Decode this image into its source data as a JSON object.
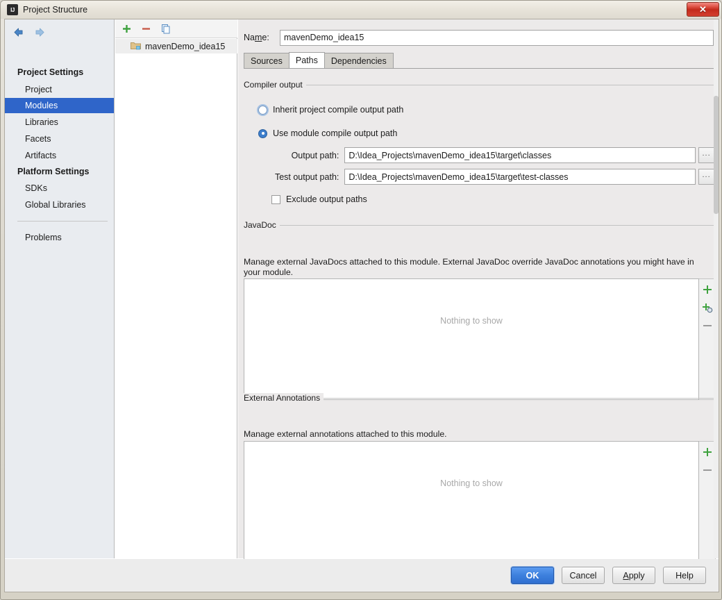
{
  "window": {
    "title": "Project Structure",
    "app_icon": "intellij-idea-icon",
    "close_label": "✕"
  },
  "sidebar": {
    "nav": {
      "back_icon": "arrow-left-icon",
      "forward_icon": "arrow-right-icon"
    },
    "groups": [
      {
        "header": "Project Settings",
        "items": [
          {
            "label": "Project",
            "selected": false
          },
          {
            "label": "Modules",
            "selected": true
          },
          {
            "label": "Libraries",
            "selected": false
          },
          {
            "label": "Facets",
            "selected": false
          },
          {
            "label": "Artifacts",
            "selected": false
          }
        ]
      },
      {
        "header": "Platform Settings",
        "items": [
          {
            "label": "SDKs",
            "selected": false
          },
          {
            "label": "Global Libraries",
            "selected": false
          }
        ]
      }
    ],
    "footer_item": {
      "label": "Problems",
      "selected": false
    }
  },
  "tree": {
    "toolbar": [
      {
        "icon": "plus-icon",
        "name": "add-module-button",
        "annotated": true
      },
      {
        "icon": "minus-icon",
        "name": "remove-module-button",
        "annotated": false
      },
      {
        "icon": "copy-icon",
        "name": "copy-module-button",
        "annotated": false
      }
    ],
    "nodes": [
      {
        "label": "mavenDemo_idea15",
        "icon": "module-folder-icon",
        "selected": true
      }
    ]
  },
  "detail": {
    "name_field": {
      "label_pre": "Na",
      "label_mnemonic": "m",
      "label_post": "e:",
      "value": "mavenDemo_idea15",
      "placeholder": ""
    },
    "tabs": [
      {
        "label": "Sources",
        "active": false
      },
      {
        "label": "Paths",
        "active": true
      },
      {
        "label": "Dependencies",
        "active": false
      }
    ],
    "compiler_output": {
      "group_title": "Compiler output",
      "radio_inherit": {
        "label": "Inherit project compile output path",
        "checked": false,
        "focused": true
      },
      "radio_module": {
        "label": "Use module compile output path",
        "checked": true,
        "focused": false
      },
      "output_path": {
        "label": "Output path:",
        "value": "D:\\Idea_Projects\\mavenDemo_idea15\\target\\classes",
        "browse_label": "..."
      },
      "test_output_path": {
        "label": "Test output path:",
        "value": "D:\\Idea_Projects\\mavenDemo_idea15\\target\\test-classes",
        "browse_label": "..."
      },
      "exclude_checkbox": {
        "label": "Exclude output paths",
        "checked": false
      }
    },
    "javadoc": {
      "group_title": "JavaDoc",
      "description": "Manage external JavaDocs attached to this module. External JavaDoc override JavaDoc annotations you might have in your module.",
      "empty_text": "Nothing to show",
      "buttons": [
        {
          "icon": "plus-icon",
          "name": "javadoc-add-button"
        },
        {
          "icon": "plus-url-icon",
          "name": "javadoc-add-url-button"
        },
        {
          "icon": "minus-icon",
          "name": "javadoc-remove-button"
        }
      ]
    },
    "external_annotations": {
      "group_title": "External Annotations",
      "description": "Manage external annotations attached to this module.",
      "empty_text": "Nothing to show",
      "buttons": [
        {
          "icon": "plus-icon",
          "name": "annotations-add-button"
        },
        {
          "icon": "minus-icon",
          "name": "annotations-remove-button"
        }
      ]
    }
  },
  "footer": {
    "buttons": [
      {
        "label": "OK",
        "mnemonic": "",
        "primary": true,
        "name": "ok-button"
      },
      {
        "label": "Cancel",
        "mnemonic": "",
        "primary": false,
        "name": "cancel-button"
      },
      {
        "label": "Apply",
        "mnemonic": "A",
        "primary": false,
        "name": "apply-button"
      },
      {
        "label": "Help",
        "mnemonic": "",
        "primary": false,
        "name": "help-button"
      }
    ]
  },
  "colors": {
    "selection_blue": "#2f65c9",
    "primary_button_blue": "#3d80dd",
    "annotation_red": "#e02b2b",
    "green_plus": "#3fa23f",
    "close_red": "#c32b1c"
  }
}
